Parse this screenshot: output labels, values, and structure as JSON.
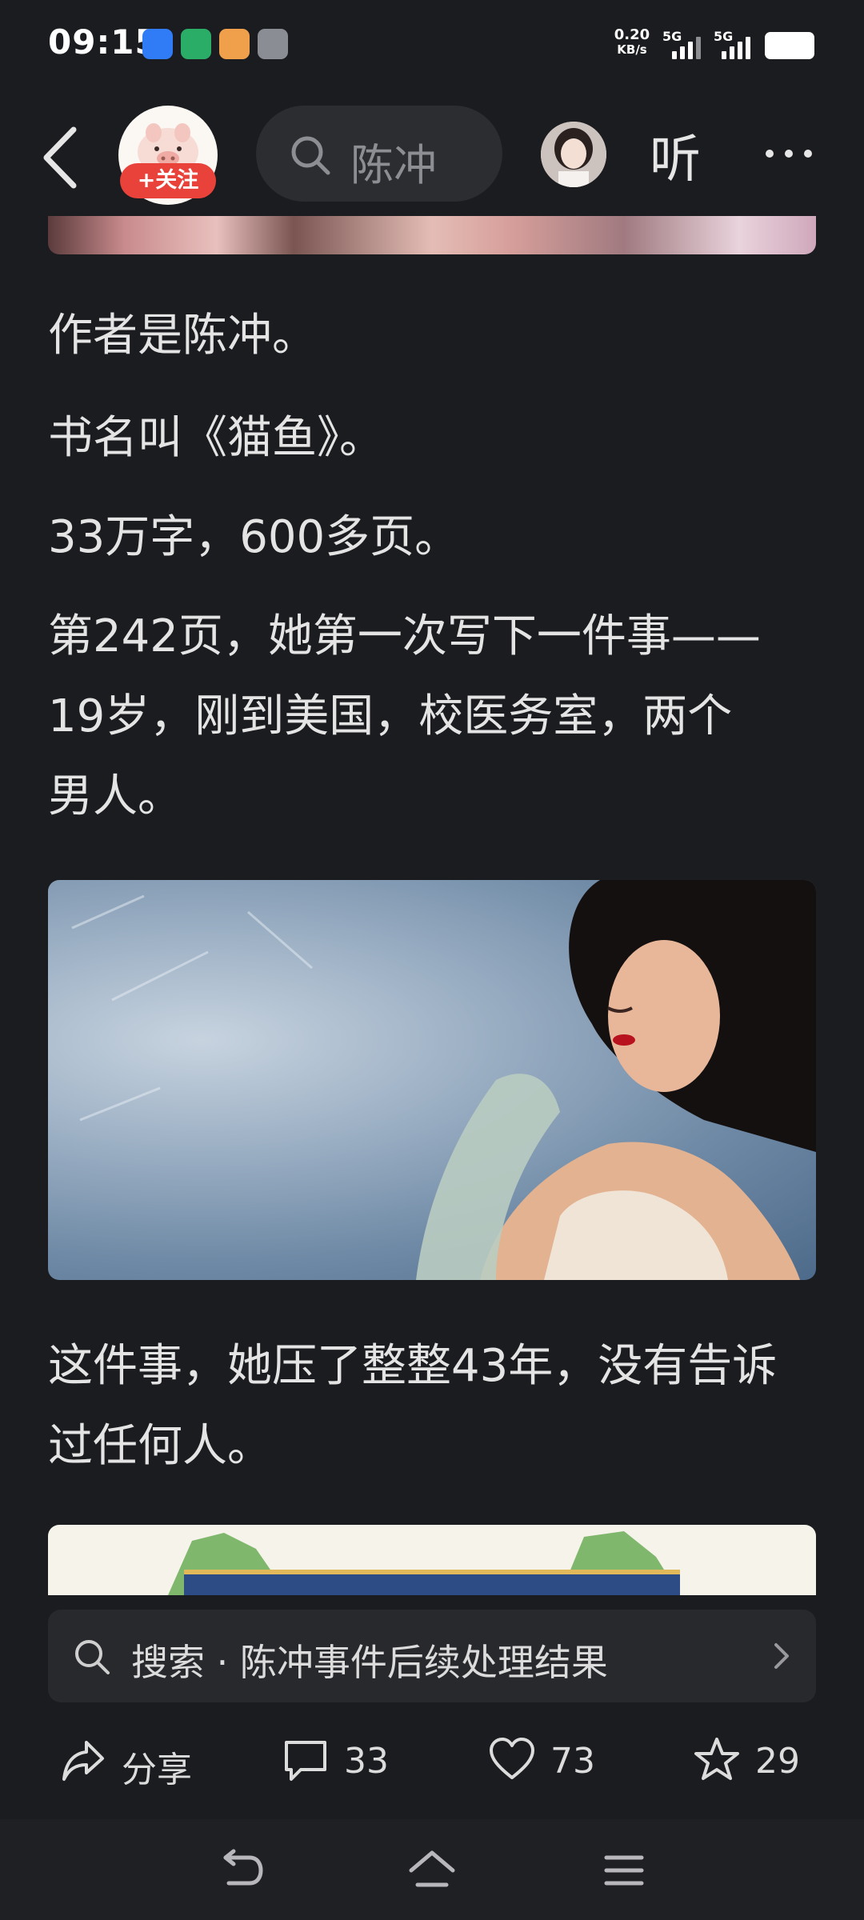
{
  "status_bar": {
    "time": "09:15",
    "net_speed_value": "0.20",
    "net_speed_unit": "KB/s",
    "sim1": "5G",
    "sim2": "5G"
  },
  "nav": {
    "follow_label": "+关注",
    "search_text": "陈冲",
    "listen_label": "听"
  },
  "article": {
    "paragraphs": [
      "作者是陈冲。",
      "书名叫《猫鱼》。",
      "33万字，600多页。",
      "第242页，她第一次写下一件事——19岁，刚到美国，校医务室，两个男人。",
      "这件事，她压了整整43年，没有告诉过任何人。"
    ]
  },
  "related_search": {
    "text": "搜索 · 陈冲事件后续处理结果"
  },
  "actions": {
    "share_label": "分享",
    "comment_count": "33",
    "like_count": "73",
    "favorite_count": "29"
  },
  "colors": {
    "background": "#1b1c1f",
    "accent_red": "#e8423a",
    "text": "#e4e4e4"
  }
}
